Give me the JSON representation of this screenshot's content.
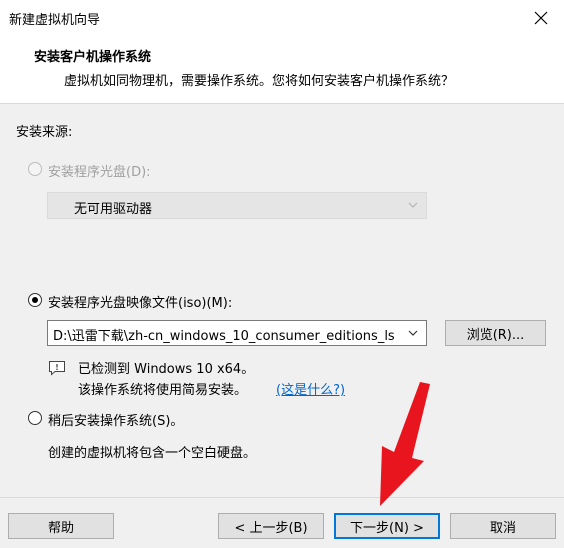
{
  "window": {
    "title": "新建虚拟机向导",
    "close_icon": "close-icon"
  },
  "header": {
    "title": "安装客户机操作系统",
    "subtitle": "虚拟机如同物理机，需要操作系统。您将如何安装客户机操作系统？"
  },
  "source": {
    "label": "安装来源:",
    "disc_option": {
      "label": "安装程序光盘(D):",
      "checked": false,
      "enabled": false
    },
    "disc_select": {
      "value": "无可用驱动器",
      "enabled": false
    },
    "iso_option": {
      "label": "安装程序光盘映像文件(iso)(M):",
      "checked": true
    },
    "iso_path": "D:\\迅雷下载\\zh-cn_windows_10_consumer_editions_ls",
    "browse_label": "浏览(R)...",
    "detected_text": "已检测到 Windows 10 x64。",
    "easy_install_text": "该操作系统将使用简易安装。",
    "whats_this_link": "(这是什么?)",
    "later_option": {
      "label": "稍后安装操作系统(S)。",
      "checked": false
    },
    "later_desc": "创建的虚拟机将包含一个空白硬盘。"
  },
  "footer": {
    "help": "帮助",
    "back": "< 上一步(B)",
    "next": "下一步(N) >",
    "cancel": "取消"
  },
  "colors": {
    "accent": "#0078d7",
    "link": "#0066cc",
    "arrow": "#e8141e"
  }
}
